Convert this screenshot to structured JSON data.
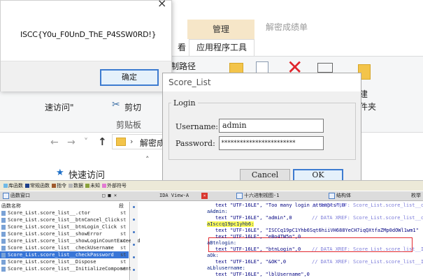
{
  "explorer": {
    "tab_manage": "管理",
    "tab_decrypt": "解密成绩单",
    "tab_suffix": "看",
    "tab_apptools": "应用程序工具",
    "ribbon_path": "制路径",
    "ribbon_new_line1": "建",
    "ribbon_new_line2": "件夹",
    "recent": "速访问\"",
    "cut": "剪切",
    "clipboard": "剪贴板",
    "address_text": "解密成",
    "quick_access": "快速访问",
    "icons": [
      "cut-icon",
      "arrow-left-icon",
      "arrow-right-icon",
      "arrow-up-icon",
      "folder-icon",
      "chevron-right-icon",
      "star-icon",
      "delete-icon"
    ],
    "colors": {
      "manage_tab": "#f6e6c8",
      "delete_x": "#e0242b"
    }
  },
  "msgbox": {
    "close_glyph": "×",
    "flag_text": "ISCC{Y0u_F0UnD_ThE_P4SSW0RD!}",
    "ok_label": "确定"
  },
  "login": {
    "title": "Score_List",
    "group_label": "Login",
    "username_label": "Username:",
    "username_value": "admin",
    "password_label": "Password:",
    "password_value": "************************",
    "cancel_label": "Cancel",
    "ok_label": "OK"
  },
  "ida": {
    "legend": [
      {
        "label": "库函数",
        "color": "#6fb9e6"
      },
      {
        "label": "常规函数",
        "color": "#1e3f8c"
      },
      {
        "label": "指令",
        "color": "#a05a2c"
      },
      {
        "label": "数据",
        "color": "#b7b7b7"
      },
      {
        "label": "未知",
        "color": "#8aa23b"
      },
      {
        "label": "外部符号",
        "color": "#e27ad2"
      }
    ],
    "tabs": {
      "functions": "函数窗口",
      "functions_controls": "□ ■ ×",
      "ida_view": "IDA View-A",
      "hex": "十六进制视图-1",
      "structs": "结构体",
      "enums": "枚举"
    },
    "functions_header": "函数名称",
    "functions_seg_header": "段",
    "functions": [
      {
        "name": "Score_List.score_list__.ctor",
        "seg": "st"
      },
      {
        "name": "Score_List.score_list__btnCancel_Click",
        "seg": "st"
      },
      {
        "name": "Score_List.score_list__btnLogin_Click",
        "seg": "st"
      },
      {
        "name": "Score_List.score_list__showError",
        "seg": "st"
      },
      {
        "name": "Score_List.score_list__showLoginCountExceeded",
        "seg": "st"
      },
      {
        "name": "Score_List.score_list__checkUsername",
        "seg": "st"
      },
      {
        "name": "Score_List.score_list__checkPassword",
        "seg": "st"
      },
      {
        "name": "Score_List.score_list__Dispose",
        "seg": "st"
      },
      {
        "name": "Score_List.score_list__InitializeComponent",
        "seg": "st"
      }
    ],
    "selected_function_index": 6,
    "code_lines": [
      {
        "text": "text \"UTF-16LE\", \"Too many login attempts\",0",
        "comment": "// DATA XREF: Score_List.score_list__check",
        "label": false
      },
      {
        "text": "aAdmin:",
        "comment": "",
        "label": true
      },
      {
        "text": "text \"UTF-16LE\", \"admin\",0",
        "comment": "// DATA XREF: Score_List.score_list__check",
        "label": false
      },
      {
        "text": "aIsccq19pc1yhb6:",
        "comment": "",
        "label": true,
        "highlight": true
      },
      {
        "text": "text \"UTF-16LE\", \"ISCCq19pC1Yhb6Sqt6hiiVH688YeCH7iqQXtfaZMp0dOWl1wm1\"",
        "comment": "",
        "label": false,
        "boxed": true
      },
      {
        "text": "text \"UTF-16LE\", \"eBo4TW5n\",0",
        "comment": "",
        "label": false,
        "boxed": true
      },
      {
        "text": "aBtnlogin:",
        "comment": "",
        "label": true
      },
      {
        "text": "text \"UTF-16LE\", \"btnLogin\",0",
        "comment": "// DATA XREF: Score_List.score_list__Initi",
        "label": false
      },
      {
        "text": "aOk:",
        "comment": "",
        "label": true
      },
      {
        "text": "text \"UTF-16LE\", \"&OK\",0",
        "comment": "// DATA XREF: Score_List.score_list__Initi",
        "label": false
      },
      {
        "text": "aLblusername:",
        "comment": "",
        "label": true
      },
      {
        "text": "text \"UTF-16LE\", \"lblUsername\",0",
        "comment": "",
        "label": false
      }
    ],
    "colors": {
      "selection": "#3875d7",
      "highlight": "#ffff55",
      "redbox": "#e2272d",
      "string": "#007a00",
      "comment": "#7b7bd9"
    }
  }
}
